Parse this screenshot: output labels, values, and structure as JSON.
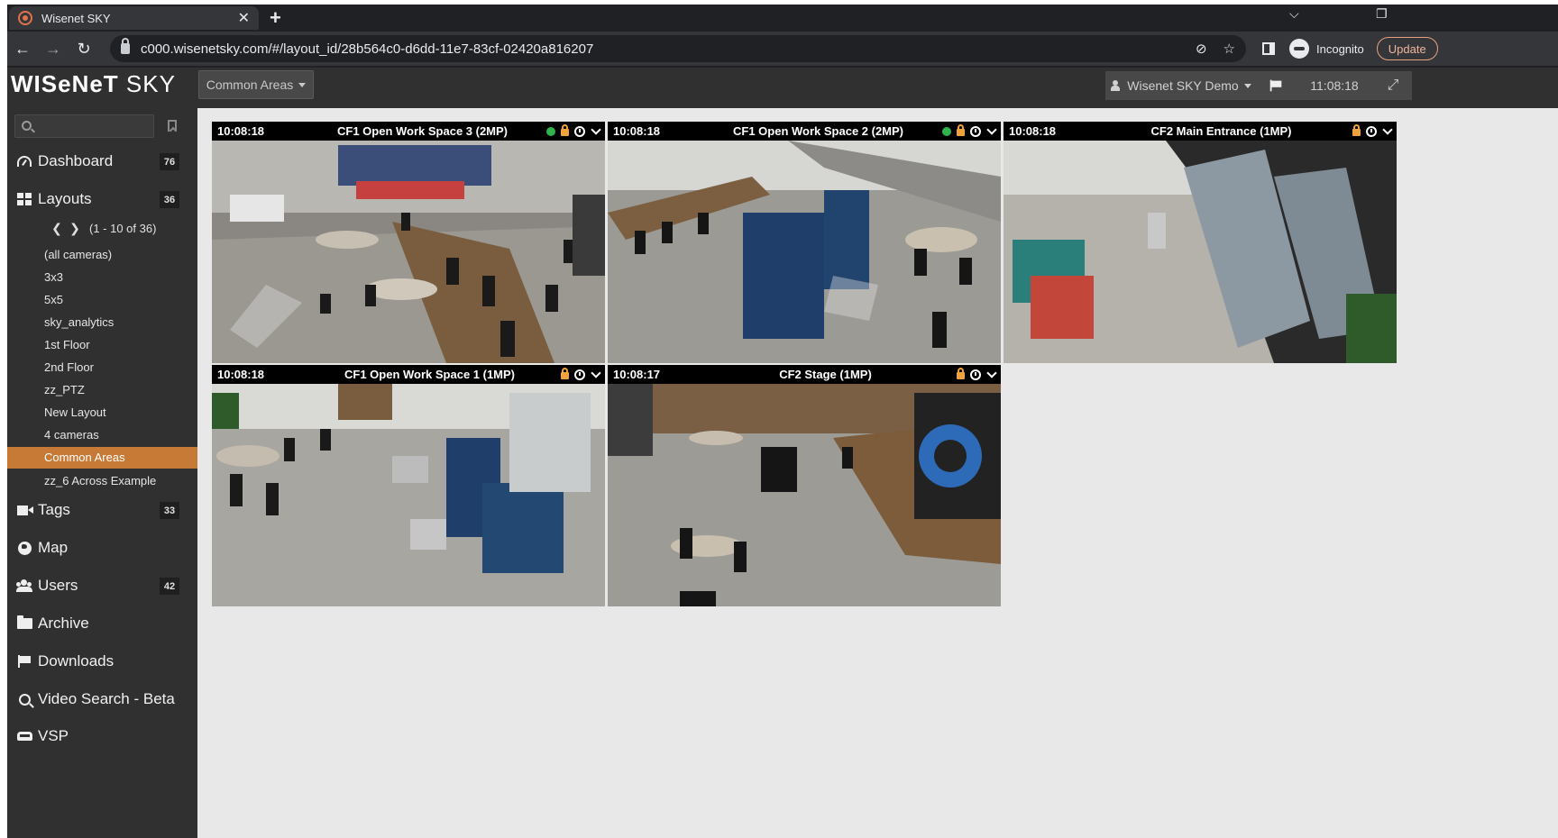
{
  "browser": {
    "tab_title": "Wisenet SKY",
    "tab_close": "✕",
    "new_tab": "+",
    "minimize": "⌵",
    "restore": "❐",
    "url": "c000.wisenetsky.com/#/layout_id/28b564c0-d6dd-11e7-83cf-02420a816207",
    "incognito_label": "Incognito",
    "update_label": "Update"
  },
  "app": {
    "logo_bold": "WISeNeT",
    "logo_thin": " SKY",
    "layout_selector": "Common Areas",
    "user_selector": "Wisenet SKY Demo",
    "clock": "11:08:18",
    "accent_color": "#c77a36",
    "selected_border_color": "#d9352b"
  },
  "sidebar": {
    "search_placeholder": "",
    "nav": [
      {
        "label": "Dashboard",
        "icon": "dashboard-icon",
        "badge": "76"
      },
      {
        "label": "Layouts",
        "icon": "grid-icon",
        "badge": "36"
      },
      {
        "label": "Tags",
        "icon": "camera-icon",
        "badge": "33"
      },
      {
        "label": "Map",
        "icon": "globe-icon",
        "badge": ""
      },
      {
        "label": "Users",
        "icon": "users-icon",
        "badge": "42"
      },
      {
        "label": "Archive",
        "icon": "folder-icon",
        "badge": ""
      },
      {
        "label": "Downloads",
        "icon": "flag-icon",
        "badge": ""
      },
      {
        "label": "Video Search - Beta",
        "icon": "search-icon",
        "badge": ""
      },
      {
        "label": "VSP",
        "icon": "car-icon",
        "badge": ""
      }
    ],
    "pager": {
      "prev": "❮",
      "next": "❯",
      "range": "(1 - 10 of 36)"
    },
    "layouts": [
      {
        "label": "(all cameras)",
        "active": false
      },
      {
        "label": "3x3",
        "active": false
      },
      {
        "label": "5x5",
        "active": false
      },
      {
        "label": "sky_analytics",
        "active": false
      },
      {
        "label": "1st Floor",
        "active": false
      },
      {
        "label": "2nd Floor",
        "active": false
      },
      {
        "label": "zz_PTZ",
        "active": false
      },
      {
        "label": "New Layout",
        "active": false
      },
      {
        "label": "4 cameras",
        "active": false
      },
      {
        "label": "Common Areas",
        "active": true
      },
      {
        "label": "zz_6 Across Example",
        "active": false
      }
    ]
  },
  "cameras": [
    {
      "time": "10:08:18",
      "name": "CF1 Open Work Space 3 (2MP)",
      "online_dot": true,
      "dot_color": "#2fb34a",
      "lock_color": "#f0a23c",
      "selected": true
    },
    {
      "time": "10:08:18",
      "name": "CF1 Open Work Space 2 (2MP)",
      "online_dot": true,
      "dot_color": "#2fb34a",
      "lock_color": "#f0a23c",
      "selected": true
    },
    {
      "time": "10:08:18",
      "name": "CF2 Main Entrance (1MP)",
      "online_dot": false,
      "dot_color": "",
      "lock_color": "#f0a23c",
      "selected": false
    },
    {
      "time": "10:08:18",
      "name": "CF1 Open Work Space 1 (1MP)",
      "online_dot": false,
      "dot_color": "",
      "lock_color": "#f0a23c",
      "selected": false
    },
    {
      "time": "10:08:17",
      "name": "CF2 Stage (1MP)",
      "online_dot": false,
      "dot_color": "",
      "lock_color": "#f0a23c",
      "selected": false
    }
  ]
}
